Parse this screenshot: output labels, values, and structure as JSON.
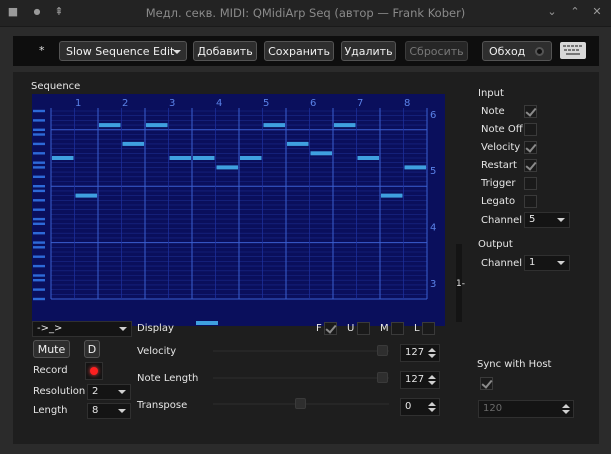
{
  "window": {
    "title": "Медл. секв. MIDI: QMidiArp Seq (автор — Frank Kober)"
  },
  "toolbar": {
    "modified_marker": "*",
    "module_select": "Slow Sequence Edit",
    "add_label": "Добавить",
    "save_label": "Сохранить",
    "delete_label": "Удалить",
    "reset_label": "Сбросить",
    "bypass_label": "Обход"
  },
  "sequence": {
    "title": "Sequence",
    "beat_labels": [
      "1",
      "2",
      "3",
      "4",
      "5",
      "6",
      "7",
      "8"
    ],
    "octave_labels": [
      "6",
      "5",
      "4",
      "3"
    ],
    "side_label": "1-",
    "notes": [
      {
        "beat": 1,
        "half": 0,
        "pitch": 54
      },
      {
        "beat": 1,
        "half": 1,
        "pitch": 46
      },
      {
        "beat": 2,
        "half": 0,
        "pitch": 61
      },
      {
        "beat": 2,
        "half": 1,
        "pitch": 57
      },
      {
        "beat": 3,
        "half": 0,
        "pitch": 61
      },
      {
        "beat": 3,
        "half": 1,
        "pitch": 54
      },
      {
        "beat": 4,
        "half": 0,
        "pitch": 54
      },
      {
        "beat": 4,
        "half": 1,
        "pitch": 52
      },
      {
        "beat": 5,
        "half": 0,
        "pitch": 54
      },
      {
        "beat": 5,
        "half": 1,
        "pitch": 61
      },
      {
        "beat": 6,
        "half": 0,
        "pitch": 57
      },
      {
        "beat": 6,
        "half": 1,
        "pitch": 55
      },
      {
        "beat": 7,
        "half": 0,
        "pitch": 61
      },
      {
        "beat": 7,
        "half": 1,
        "pitch": 54
      },
      {
        "beat": 8,
        "half": 0,
        "pitch": 46
      },
      {
        "beat": 8,
        "half": 1,
        "pitch": 52
      }
    ]
  },
  "controls": {
    "loop_mode": "->_>",
    "mute_label": "Mute",
    "d_label": "D",
    "record_label": "Record",
    "resolution_label": "Resolution",
    "resolution_value": "2",
    "length_label": "Length",
    "length_value": "8",
    "display_label": "Display",
    "display_f": "F",
    "display_u": "U",
    "display_m": "M",
    "display_l": "L",
    "velocity_label": "Velocity",
    "velocity_value": "127",
    "note_length_label": "Note Length",
    "note_length_value": "127",
    "transpose_label": "Transpose",
    "transpose_value": "0"
  },
  "input": {
    "title": "Input",
    "note": "Note",
    "note_off": "Note Off",
    "velocity": "Velocity",
    "restart": "Restart",
    "trigger": "Trigger",
    "legato": "Legato",
    "channel_label": "Channel",
    "channel_value": "5"
  },
  "output": {
    "title": "Output",
    "channel_label": "Channel",
    "channel_value": "1"
  },
  "sync": {
    "label": "Sync with Host",
    "tempo": "120"
  },
  "colors": {
    "grid_bg": "#0a0f5c",
    "note": "#3fa0e0",
    "record_led": "#ff2020"
  }
}
